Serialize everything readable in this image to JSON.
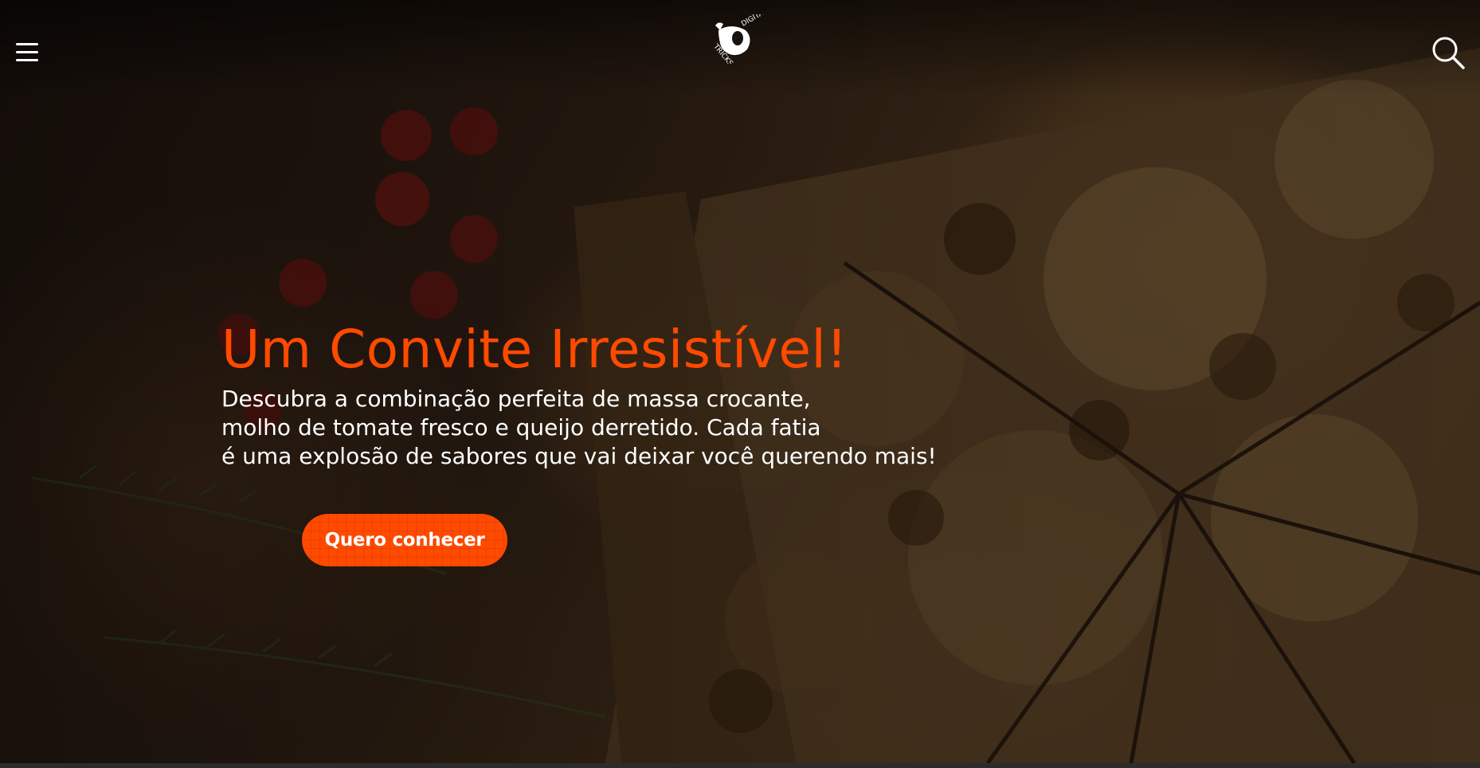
{
  "header": {
    "menu_icon": "hamburger-menu-icon",
    "logo_text_top": "DIGITAL",
    "logo_text_bottom": "TRICKS",
    "search_icon": "search-icon"
  },
  "hero": {
    "headline": "Um Convite Irresistível!",
    "description_lines": [
      "Descubra a combinação perfeita de massa crocante,",
      "molho de tomate fresco e queijo derretido. Cada fatia",
      "é uma explosão de sabores que vai deixar você querendo mais!"
    ],
    "cta_label": "Quero conhecer"
  },
  "colors": {
    "accent": "#ff4a00",
    "text": "#ffffff",
    "background": "#1a120c"
  }
}
